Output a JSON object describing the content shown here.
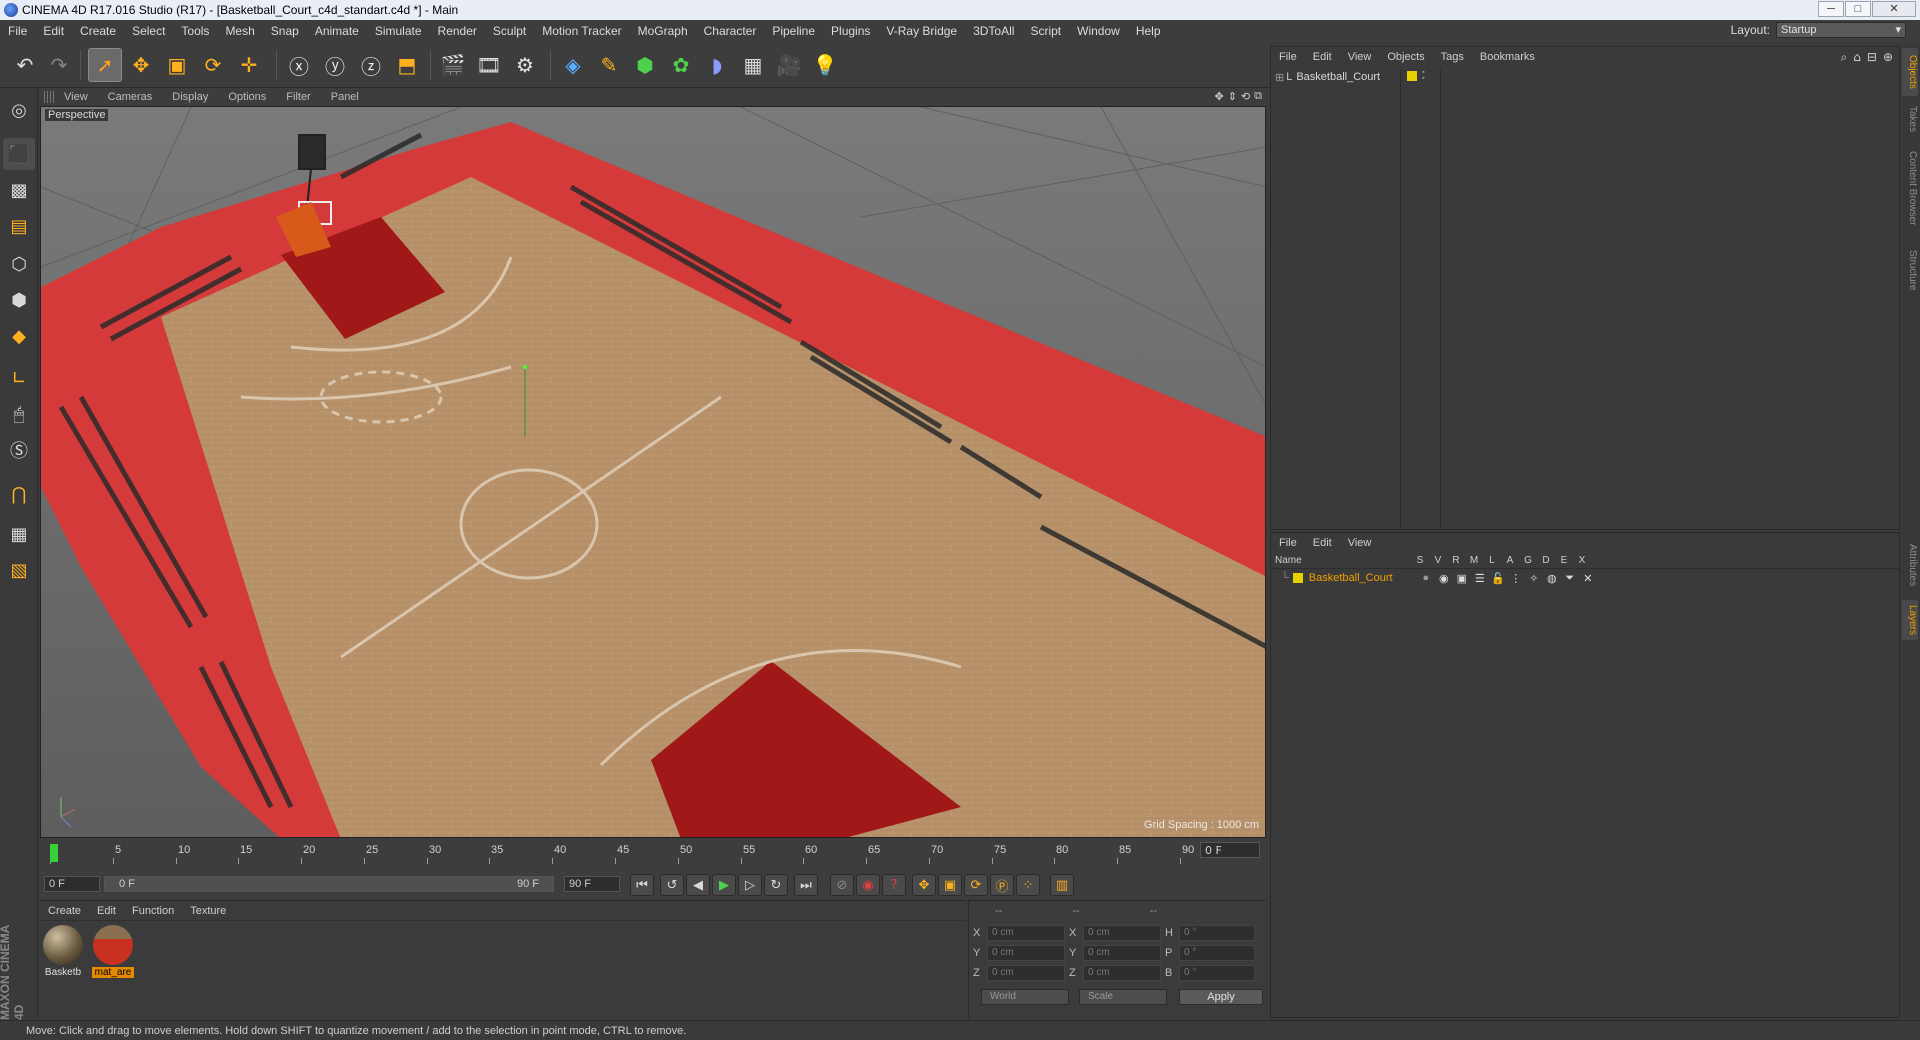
{
  "window": {
    "title": "CINEMA 4D R17.016 Studio (R17) - [Basketball_Court_c4d_standart.c4d *] - Main",
    "minimize": "─",
    "maximize": "□",
    "close": "✕"
  },
  "menubar": {
    "items": [
      "File",
      "Edit",
      "Create",
      "Select",
      "Tools",
      "Mesh",
      "Snap",
      "Animate",
      "Simulate",
      "Render",
      "Sculpt",
      "Motion Tracker",
      "MoGraph",
      "Character",
      "Pipeline",
      "Plugins",
      "V-Ray Bridge",
      "3DToAll",
      "Script",
      "Window",
      "Help"
    ],
    "layout_label": "Layout:",
    "layout_value": "Startup"
  },
  "viewport": {
    "menu": [
      "View",
      "Cameras",
      "Display",
      "Options",
      "Filter",
      "Panel"
    ],
    "label": "Perspective",
    "grid_spacing": "Grid Spacing : 1000 cm",
    "court_color": "#b8926a",
    "stand_color": "#d43a3a",
    "key_color": "#a01818"
  },
  "timeline": {
    "ticks": [
      "0",
      "5",
      "10",
      "15",
      "20",
      "25",
      "30",
      "35",
      "40",
      "45",
      "50",
      "55",
      "60",
      "65",
      "70",
      "75",
      "80",
      "85",
      "90"
    ],
    "current_frame": "0 F",
    "start_field": "0 F",
    "range_start": "0 F",
    "range_end": "90 F",
    "end_field": "90 F"
  },
  "material_manager": {
    "menu": [
      "Create",
      "Edit",
      "Function",
      "Texture"
    ],
    "materials": [
      {
        "name": "Basketb",
        "selected": false
      },
      {
        "name": "mat_are",
        "selected": true
      }
    ]
  },
  "coordinates": {
    "headers": [
      "--",
      "--",
      "--"
    ],
    "rows": [
      {
        "a_label": "X",
        "a_value": "0 cm",
        "b_label": "X",
        "b_value": "0 cm",
        "c_label": "H",
        "c_value": "0 °"
      },
      {
        "a_label": "Y",
        "a_value": "0 cm",
        "b_label": "Y",
        "b_value": "0 cm",
        "c_label": "P",
        "c_value": "0 °"
      },
      {
        "a_label": "Z",
        "a_value": "0 cm",
        "b_label": "Z",
        "b_value": "0 cm",
        "c_label": "B",
        "c_value": "0 °"
      }
    ],
    "mode": "World",
    "transform": "Scale",
    "apply": "Apply"
  },
  "object_manager": {
    "menu": [
      "File",
      "Edit",
      "View",
      "Objects",
      "Tags",
      "Bookmarks"
    ],
    "objects": [
      {
        "name": "Basketball_Court"
      }
    ]
  },
  "layer_manager": {
    "menu": [
      "File",
      "Edit",
      "View"
    ],
    "columns": [
      "Name",
      "S",
      "V",
      "R",
      "M",
      "L",
      "A",
      "G",
      "D",
      "E",
      "X"
    ],
    "layers": [
      {
        "name": "Basketball_Court",
        "color": "#e6d200"
      }
    ]
  },
  "side_tabs": [
    "Objects",
    "Takes",
    "Content Browser",
    "Structure",
    "Attributes",
    "Layers"
  ],
  "logo": "MAXON CINEMA 4D",
  "status": "Move: Click and drag to move elements. Hold down SHIFT to quantize movement / add to the selection in point mode, CTRL to remove."
}
